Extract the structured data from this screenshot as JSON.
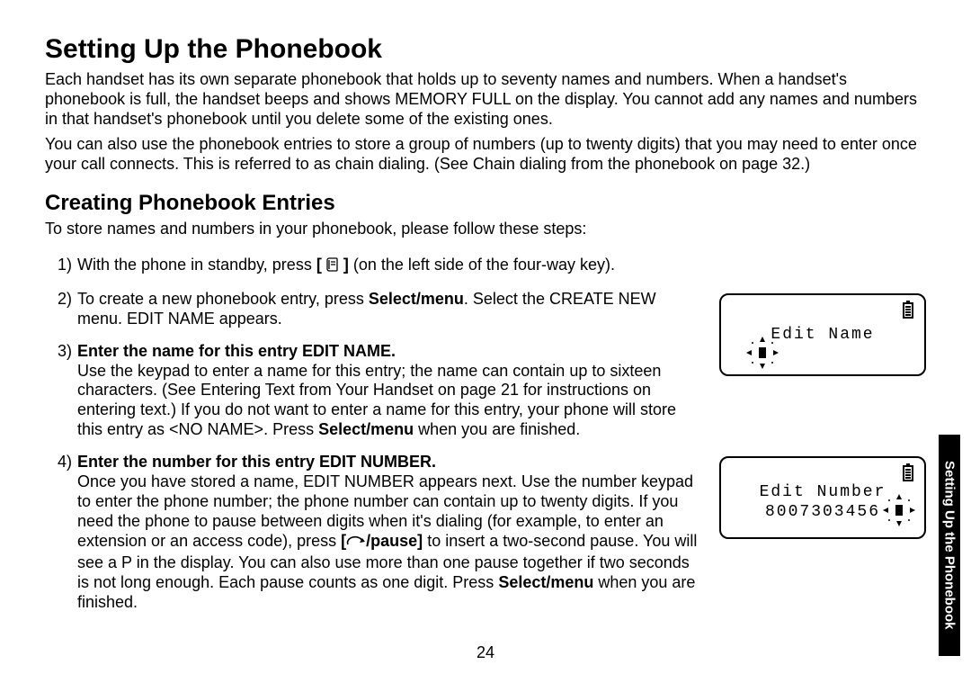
{
  "title": "Setting Up the Phonebook",
  "intro_p1": "Each handset has its own separate phonebook that holds up to seventy names and numbers. When a handset's phonebook is full, the handset beeps and shows MEMORY FULL on the display. You cannot add any names and numbers in that handset's phonebook until you delete some of the existing ones.",
  "intro_p2": "You can also use the phonebook entries to store a group of numbers (up to twenty digits) that you may need to enter once your call connects. This is referred to as chain dialing. (See Chain dialing from the phonebook on page 32.)",
  "subheading": "Creating Phonebook Entries",
  "sub_intro": "To store names and numbers in your phonebook, please follow these steps:",
  "step1_num": "1)",
  "step1_a": "With the phone in standby, press ",
  "step1_b": " (on the left side of the four-way key).",
  "step2_num": "2)",
  "step2_a": "To create a new phonebook entry, press ",
  "step2_b": ". Select the CREATE NEW menu. EDIT NAME appears.",
  "step2_bold": "Select/menu",
  "lcd1_line1": "Edit Name",
  "step3_num": "3)",
  "step3_title": "Enter the name for this entry EDIT NAME.",
  "step3_body_a": "Use the keypad to enter a name for this entry; the name can contain up to sixteen characters. (See Entering Text from Your Handset on page 21 for instructions on entering text.) If you do not want to enter a name for this entry, your phone will store this entry as <NO NAME>. Press ",
  "step3_body_b": " when you are finished.",
  "step3_bold": "Select/menu",
  "step4_num": "4)",
  "step4_title": "Enter the number for this entry EDIT NUMBER.",
  "step4_body_a": "Once you have stored a name, EDIT NUMBER appears next. Use the number keypad to enter the phone number; the phone number can contain up to twenty digits. If you need the phone to pause between digits when it's dialing (for example, to enter an extension or an access code), press ",
  "step4_body_b": " to insert a two-second pause. You will see a P in the display. You can also use more than one pause together if two seconds is not long enough. Each pause counts as one digit. Press ",
  "step4_body_c": " when you are finished.",
  "step4_bold1": "/pause]",
  "step4_bold2": "Select/menu",
  "lcd2_line1": "Edit Number",
  "lcd2_line2": "8007303456",
  "page_number": "24",
  "side_tab": "Setting Up the Phonebook"
}
